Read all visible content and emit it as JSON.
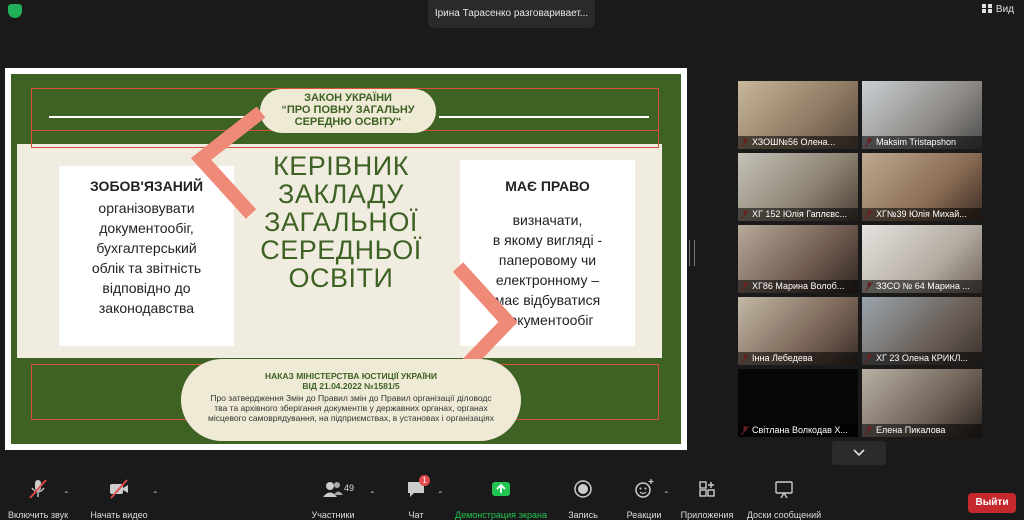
{
  "topbar": {
    "speaking_text": "Ірина Тарасенко разговаривает...",
    "view_label": "Вид"
  },
  "slide": {
    "top_pill_line1": "ЗАКОН УКРАЇНИ",
    "top_pill_line2": "“ПРО ПОВНУ ЗАГАЛЬНУ",
    "top_pill_line3": "СЕРЕДНЮ ОСВІТУ“",
    "left_heading": "ЗОБОВ'ЯЗАНИЙ",
    "left_text": [
      "організовувати",
      "документообіг,",
      "бухгалтерський",
      "облік та звітність",
      "відповідно до",
      "законодавства"
    ],
    "center_title": [
      "КЕРІВНИК",
      "ЗАКЛАДУ",
      "ЗАГАЛЬНОЇ",
      "СЕРЕДНЬОЇ",
      "ОСВІТИ"
    ],
    "right_heading": "МАЄ ПРАВО",
    "right_text": [
      "визначати,",
      "в якому вигляді -",
      "паперовому чи",
      "електронному –",
      "має відбуватися",
      "документообіг"
    ],
    "bottom_title1": "НАКАЗ МІНІСТЕРСТВА ЮСТИЦІЇ УКРАЇНИ",
    "bottom_title2": "ВІД 21.04.2022 №1581/5",
    "bottom_text": [
      "Про затвердження Змін до Правил змін до Правил організації діловодс",
      "тва та архівного зберігання документів у державних органах, органах",
      "місцевого самоврядування, на підприємствах, в установах і організаціях"
    ]
  },
  "participants": [
    "ХЗОШ№56 Олена...",
    "Maksim Tristapshon",
    "ХГ 152 Юлія Гаплєвс...",
    "ХГ№39 Юлія Михай...",
    "ХГ86 Марина Волоб...",
    "ЗЗСО № 64 Марина ...",
    "Інна Лебедева",
    "ХГ 23 Олена КРИКЛ...",
    "Світлана Волкодав Х...",
    "Елена Пикалова"
  ],
  "toolbar": {
    "audio": "Включить звук",
    "video": "Начать видео",
    "participants": "Участники",
    "participants_count": "49",
    "chat": "Чат",
    "chat_badge": "1",
    "share": "Демонстрация экрана",
    "record": "Запись",
    "reactions": "Реакции",
    "apps": "Приложения",
    "whiteboards": "Доски сообщений",
    "leave": "Выйти"
  },
  "colors": {
    "slide_green": "#3e6224",
    "slide_cream": "#f1ece0",
    "arrow_salmon": "#f08a78",
    "share_green": "#23c552",
    "leave_red": "#c5292e"
  }
}
